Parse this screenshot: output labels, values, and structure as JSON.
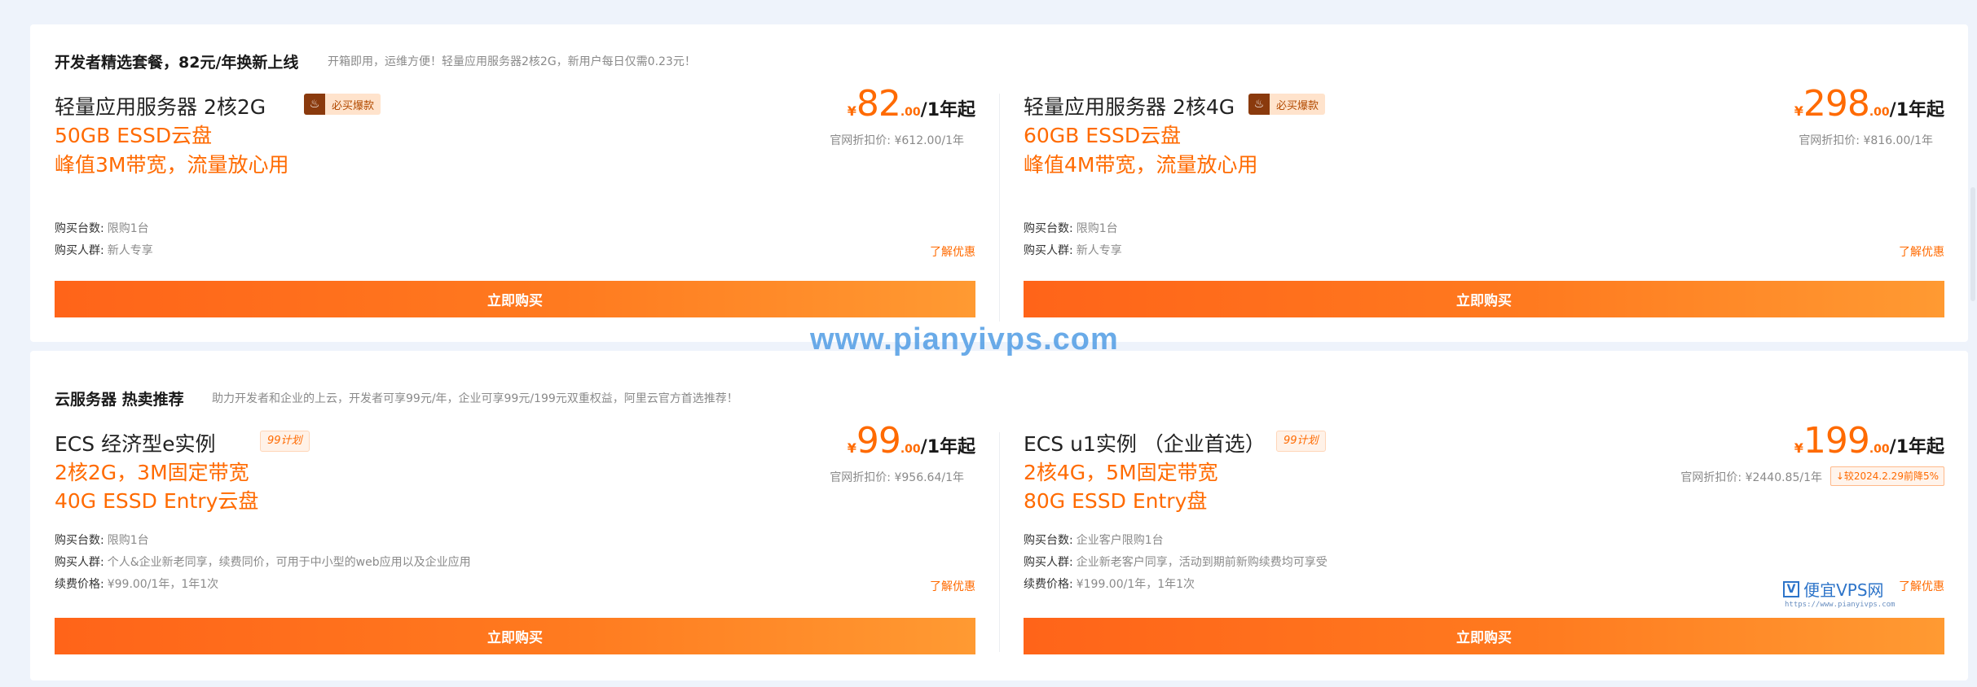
{
  "section1": {
    "title": "开发者精选套餐，82元/年换新上线",
    "subtitle": "开箱即用，运维方便！轻量应用服务器2核2G，新用户每日仅需0.23元！",
    "products": [
      {
        "name": "轻量应用服务器 2核2G",
        "badge": "必买爆款",
        "spec1": "50GB ESSD云盘",
        "spec2": "峰值3M带宽，流量放心用",
        "price_currency": "¥",
        "price_int": "82",
        "price_dec": ".00",
        "price_unit": "/1年起",
        "orig_price": "官网折扣价: ¥612.00/1年",
        "qty_label": "购买台数:",
        "qty_value": "限购1台",
        "group_label": "购买人群:",
        "group_value": "新人专享",
        "learn": "了解优惠",
        "buy": "立即购买"
      },
      {
        "name": "轻量应用服务器 2核4G",
        "badge": "必买爆款",
        "spec1": "60GB ESSD云盘",
        "spec2": "峰值4M带宽，流量放心用",
        "price_currency": "¥",
        "price_int": "298",
        "price_dec": ".00",
        "price_unit": "/1年起",
        "orig_price": "官网折扣价: ¥816.00/1年",
        "qty_label": "购买台数:",
        "qty_value": "限购1台",
        "group_label": "购买人群:",
        "group_value": "新人专享",
        "learn": "了解优惠",
        "buy": "立即购买"
      }
    ]
  },
  "section2": {
    "title": "云服务器 热卖推荐",
    "subtitle": "助力开发者和企业的上云，开发者可享99元/年，企业可享99元/199元双重权益，阿里云官方首选推荐！",
    "products": [
      {
        "name": "ECS 经济型e实例",
        "badge": "99计划",
        "spec1": "2核2G，3M固定带宽",
        "spec2": "40G ESSD Entry云盘",
        "price_currency": "¥",
        "price_int": "99",
        "price_dec": ".00",
        "price_unit": "/1年起",
        "orig_price": "官网折扣价: ¥956.64/1年",
        "qty_label": "购买台数:",
        "qty_value": "限购1台",
        "group_label": "购买人群:",
        "group_value": "个人&企业新老同享，续费同价，可用于中小型的web应用以及企业应用",
        "renew_label": "续费价格:",
        "renew_value": "¥99.00/1年，1年1次",
        "learn": "了解优惠",
        "buy": "立即购买"
      },
      {
        "name": "ECS u1实例 （企业首选）",
        "badge": "99计划",
        "spec1": "2核4G，5M固定带宽",
        "spec2": "80G ESSD Entry盘",
        "price_currency": "¥",
        "price_int": "199",
        "price_dec": ".00",
        "price_unit": "/1年起",
        "orig_price": "官网折扣价: ¥2440.85/1年",
        "tax_tag": "↓较2024.2.29前降5%",
        "qty_label": "购买台数:",
        "qty_value": "企业客户限购1台",
        "group_label": "购买人群:",
        "group_value": "企业新老客户同享，活动到期前新购续费均可享受",
        "renew_label": "续费价格:",
        "renew_value": "¥199.00/1年，1年1次",
        "learn": "了解优惠",
        "buy": "立即购买"
      }
    ]
  },
  "watermark": "www.pianyivps.com",
  "logo_watermark": {
    "mark": "V",
    "text": "便宜VPS网",
    "url": "https://www.pianyivps.com"
  },
  "colors": {
    "accent": "#ff6a00",
    "background": "#eef3fb",
    "watermark": "#5aa2e6"
  },
  "icons": {
    "badge_hot": "fire-icon"
  }
}
